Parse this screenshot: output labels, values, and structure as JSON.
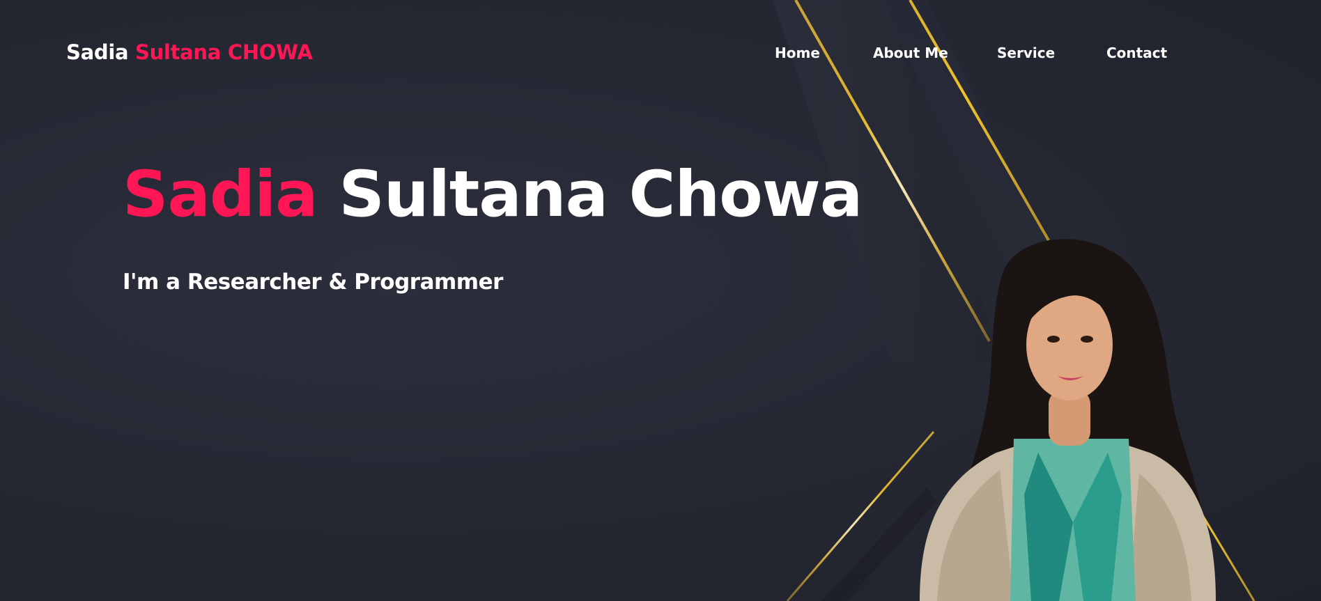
{
  "brand": {
    "first": "Sadia",
    "rest": "Sultana CHOWA"
  },
  "nav": {
    "items": [
      {
        "label": "Home"
      },
      {
        "label": "About Me"
      },
      {
        "label": "Service"
      },
      {
        "label": "Contact"
      }
    ]
  },
  "hero": {
    "title_first": "Sadia",
    "title_rest": "Sultana Chowa",
    "subtitle": "I'm a Researcher & Programmer"
  },
  "colors": {
    "background": "#262834",
    "accent": "#ff1654",
    "text": "#ffffff",
    "gold_line": "#d4a82a"
  }
}
